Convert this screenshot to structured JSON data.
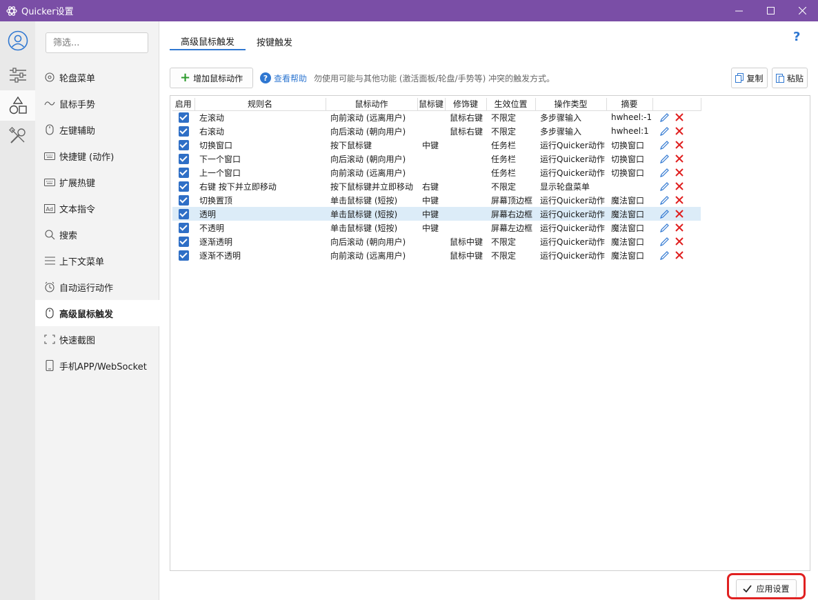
{
  "window": {
    "title": "Quicker设置"
  },
  "rail": {
    "items": [
      "profile-icon",
      "sliders-icon",
      "shapes-icon",
      "tools-icon"
    ],
    "active_index": 2
  },
  "nav": {
    "filter_placeholder": "筛选...",
    "items": [
      {
        "label": "轮盘菜单",
        "icon": "wheel-icon"
      },
      {
        "label": "鼠标手势",
        "icon": "gesture-icon"
      },
      {
        "label": "左键辅助",
        "icon": "mouse-icon"
      },
      {
        "label": "快捷键 (动作)",
        "icon": "keyboard-icon"
      },
      {
        "label": "扩展热键",
        "icon": "keyboard-icon"
      },
      {
        "label": "文本指令",
        "icon": "ad-icon"
      },
      {
        "label": "搜索",
        "icon": "search-icon"
      },
      {
        "label": "上下文菜单",
        "icon": "menu-icon"
      },
      {
        "label": "自动运行动作",
        "icon": "alarm-icon"
      },
      {
        "label": "高级鼠标触发",
        "icon": "mouse-icon"
      },
      {
        "label": "快速截图",
        "icon": "screenshot-icon"
      },
      {
        "label": "手机APP/WebSocket",
        "icon": "phone-icon"
      }
    ],
    "active_index": 9
  },
  "tabs": [
    {
      "label": "高级鼠标触发"
    },
    {
      "label": "按键触发"
    }
  ],
  "toolbar": {
    "add_label": "增加鼠标动作",
    "help_label": "查看帮助",
    "hint": "勿使用可能与其他功能 (激活面板/轮盘/手势等) 冲突的触发方式。",
    "copy_label": "复制",
    "paste_label": "粘贴"
  },
  "table": {
    "columns": [
      "启用",
      "规则名",
      "鼠标动作",
      "鼠标键",
      "修饰键",
      "生效位置",
      "操作类型",
      "摘要",
      ""
    ],
    "rows": [
      {
        "enabled": true,
        "name": "左滚动",
        "action": "向前滚动 (远离用户)",
        "button": "",
        "modifier": "鼠标右键",
        "position": "不限定",
        "op_type": "多步骤输入",
        "summary": "hwheel:-1"
      },
      {
        "enabled": true,
        "name": "右滚动",
        "action": "向后滚动 (朝向用户)",
        "button": "",
        "modifier": "鼠标右键",
        "position": "不限定",
        "op_type": "多步骤输入",
        "summary": "hwheel:1"
      },
      {
        "enabled": true,
        "name": "切换窗口",
        "action": "按下鼠标键",
        "button": "中键",
        "modifier": "",
        "position": "任务栏",
        "op_type": "运行Quicker动作",
        "summary": "切换窗口"
      },
      {
        "enabled": true,
        "name": "下一个窗口",
        "action": "向后滚动 (朝向用户)",
        "button": "",
        "modifier": "",
        "position": "任务栏",
        "op_type": "运行Quicker动作",
        "summary": "切换窗口"
      },
      {
        "enabled": true,
        "name": "上一个窗口",
        "action": "向前滚动 (远离用户)",
        "button": "",
        "modifier": "",
        "position": "任务栏",
        "op_type": "运行Quicker动作",
        "summary": "切换窗口"
      },
      {
        "enabled": true,
        "name": "右键 按下并立即移动",
        "action": "按下鼠标键并立即移动",
        "button": "右键",
        "modifier": "",
        "position": "不限定",
        "op_type": "显示轮盘菜单",
        "summary": ""
      },
      {
        "enabled": true,
        "name": "切换置顶",
        "action": "单击鼠标键 (短按)",
        "button": "中键",
        "modifier": "",
        "position": "屏幕顶边框",
        "op_type": "运行Quicker动作",
        "summary": "魔法窗口"
      },
      {
        "enabled": true,
        "name": "透明",
        "action": "单击鼠标键 (短按)",
        "button": "中键",
        "modifier": "",
        "position": "屏幕右边框",
        "op_type": "运行Quicker动作",
        "summary": "魔法窗口"
      },
      {
        "enabled": true,
        "name": "不透明",
        "action": "单击鼠标键 (短按)",
        "button": "中键",
        "modifier": "",
        "position": "屏幕左边框",
        "op_type": "运行Quicker动作",
        "summary": "魔法窗口"
      },
      {
        "enabled": true,
        "name": "逐渐透明",
        "action": "向后滚动 (朝向用户)",
        "button": "",
        "modifier": "鼠标中键",
        "position": "不限定",
        "op_type": "运行Quicker动作",
        "summary": "魔法窗口"
      },
      {
        "enabled": true,
        "name": "逐渐不透明",
        "action": "向前滚动 (远离用户)",
        "button": "",
        "modifier": "鼠标中键",
        "position": "不限定",
        "op_type": "运行Quicker动作",
        "summary": "魔法窗口"
      }
    ],
    "selected_index": 7
  },
  "footer": {
    "apply_label": "应用设置"
  },
  "colors": {
    "titlebar": "#7a4ea6",
    "accent": "#2f77d1",
    "highlight": "#e02020"
  }
}
